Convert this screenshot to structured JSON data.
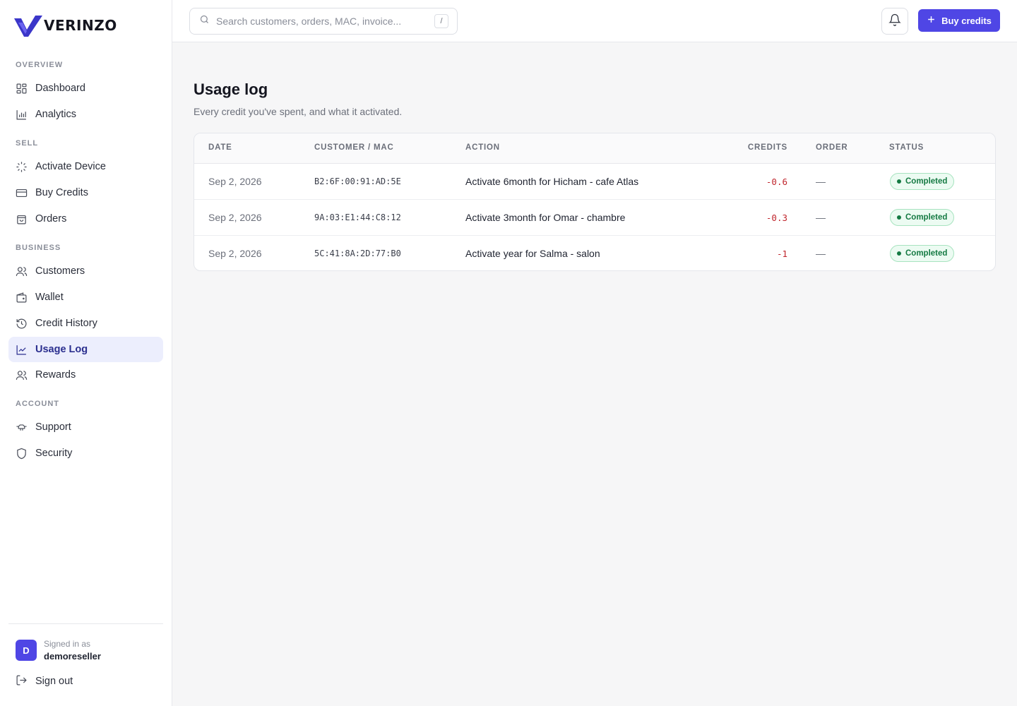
{
  "brand": {
    "name": "VERINZO"
  },
  "sidebar": {
    "sections": [
      {
        "title": "OVERVIEW",
        "items": [
          {
            "label": "Dashboard",
            "icon": "dashboard-icon"
          },
          {
            "label": "Analytics",
            "icon": "bar-chart-icon"
          }
        ]
      },
      {
        "title": "SELL",
        "items": [
          {
            "label": "Activate Device",
            "icon": "sparkle-loader-icon"
          },
          {
            "label": "Buy Credits",
            "icon": "credit-card-icon"
          },
          {
            "label": "Orders",
            "icon": "shopping-bag-icon"
          }
        ]
      },
      {
        "title": "BUSINESS",
        "items": [
          {
            "label": "Customers",
            "icon": "users-icon"
          },
          {
            "label": "Wallet",
            "icon": "wallet-icon"
          },
          {
            "label": "Credit History",
            "icon": "history-icon"
          },
          {
            "label": "Usage Log",
            "icon": "line-chart-icon",
            "active": true
          },
          {
            "label": "Rewards",
            "icon": "users-icon"
          }
        ]
      },
      {
        "title": "ACCOUNT",
        "items": [
          {
            "label": "Support",
            "icon": "support-icon"
          },
          {
            "label": "Security",
            "icon": "shield-icon"
          }
        ]
      }
    ],
    "user": {
      "initial": "D",
      "signed_in_label": "Signed in as",
      "username": "demoreseller"
    },
    "signout_label": "Sign out"
  },
  "topbar": {
    "search_placeholder": "Search customers, orders, MAC, invoice...",
    "search_shortcut": "/",
    "buy_label": "Buy credits"
  },
  "page": {
    "title": "Usage log",
    "subtitle": "Every credit you've spent, and what it activated."
  },
  "table": {
    "columns": [
      "DATE",
      "CUSTOMER / MAC",
      "ACTION",
      "CREDITS",
      "ORDER",
      "STATUS"
    ],
    "rows": [
      {
        "date": "Sep 2, 2026",
        "mac": "B2:6F:00:91:AD:5E",
        "action": "Activate 6month for Hicham - cafe Atlas",
        "credits": "-0.6",
        "order": "—",
        "status": "Completed"
      },
      {
        "date": "Sep 2, 2026",
        "mac": "9A:03:E1:44:C8:12",
        "action": "Activate 3month for Omar - chambre",
        "credits": "-0.3",
        "order": "—",
        "status": "Completed"
      },
      {
        "date": "Sep 2, 2026",
        "mac": "5C:41:8A:2D:77:B0",
        "action": "Activate year for Salma - salon",
        "credits": "-1",
        "order": "—",
        "status": "Completed"
      }
    ]
  },
  "colors": {
    "accent": "#4f46e5",
    "negative": "#c0262d",
    "success": "#157a43"
  }
}
